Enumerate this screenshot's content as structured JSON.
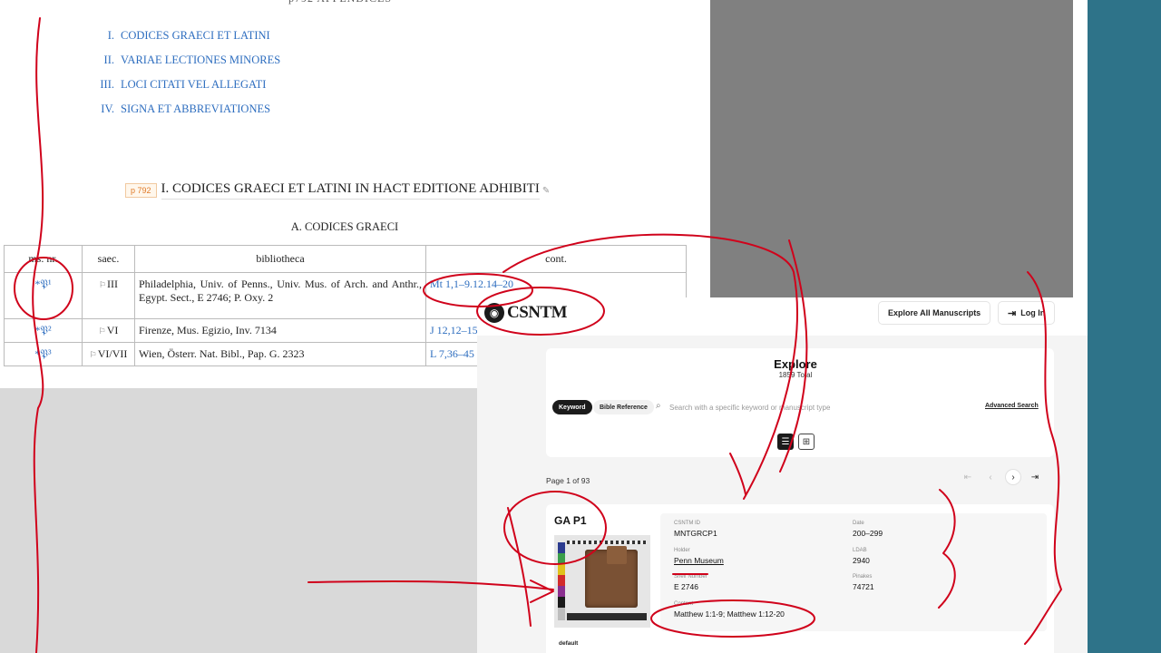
{
  "edition": {
    "toc": [
      {
        "num": "I.",
        "label": "CODICES GRAECI ET LATINI"
      },
      {
        "num": "II.",
        "label": "VARIAE LECTIONES MINORES"
      },
      {
        "num": "III.",
        "label": "LOCI CITATI VEL ALLEGATI"
      },
      {
        "num": "IV.",
        "label": "SIGNA ET ABBREVIATIONES"
      }
    ],
    "page_tag": "p 792",
    "section_title": "I. CODICES GRAECI ET LATINI IN HACT EDITIONE ADHIBITI",
    "subsection_title": "A. CODICES GRAECI",
    "table": {
      "headers": [
        "ms. nr.",
        "saec.",
        "bibliotheca",
        "cont."
      ],
      "rows": [
        {
          "ms": "*𝔓¹",
          "saec": "III",
          "bibliotheca": "Philadelphia, Univ. of Penns., Univ. Mus. of Arch. and Anthr., Egypt. Sect., E 2746; P. Oxy. 2",
          "cont": "Mt 1,1–9.12.14–20"
        },
        {
          "ms": "*𝔓²",
          "saec": "VI",
          "bibliotheca": "Firenze, Mus. Egizio, Inv. 7134",
          "cont": "J 12,12–15"
        },
        {
          "ms": "*𝔓³",
          "saec": "VI/VII",
          "bibliotheca": "Wien, Österr. Nat. Bibl., Pap. G. 2323",
          "cont": "L 7,36–45"
        }
      ]
    }
  },
  "csntm": {
    "logo_text": "CSNTM",
    "nav": {
      "explore_all": "Explore All Manuscripts",
      "login": "Log In"
    },
    "explore": {
      "title": "Explore",
      "total": "1859 Total",
      "tabs": [
        "Keyword",
        "Bible Reference"
      ],
      "active_tab": "Keyword",
      "search_placeholder": "Search with a specific keyword or manuscript type",
      "advanced_search": "Advanced Search"
    },
    "page_info": "Page 1 of 93",
    "result": {
      "title": "GA P1",
      "image_caption": "default",
      "fields": {
        "csntm_id_label": "CSNTM ID",
        "csntm_id": "MNTGRCP1",
        "date_label": "Date",
        "date": "200–299",
        "holder_label": "Holder",
        "holder": "Penn Museum",
        "ldab_label": "LDAB",
        "ldab": "2940",
        "shelf_label": "Shelf Number",
        "shelf": "E 2746",
        "pinakes_label": "Pinakes",
        "pinakes": "74721",
        "content_label": "Content",
        "content": "Matthew 1:1-9; Matthew 1:12-20"
      }
    }
  },
  "colors": {
    "link_blue": "#2d6dbf",
    "annotation_red": "#d0021b",
    "teal": "#2e7389",
    "video_gray": "#808080"
  }
}
